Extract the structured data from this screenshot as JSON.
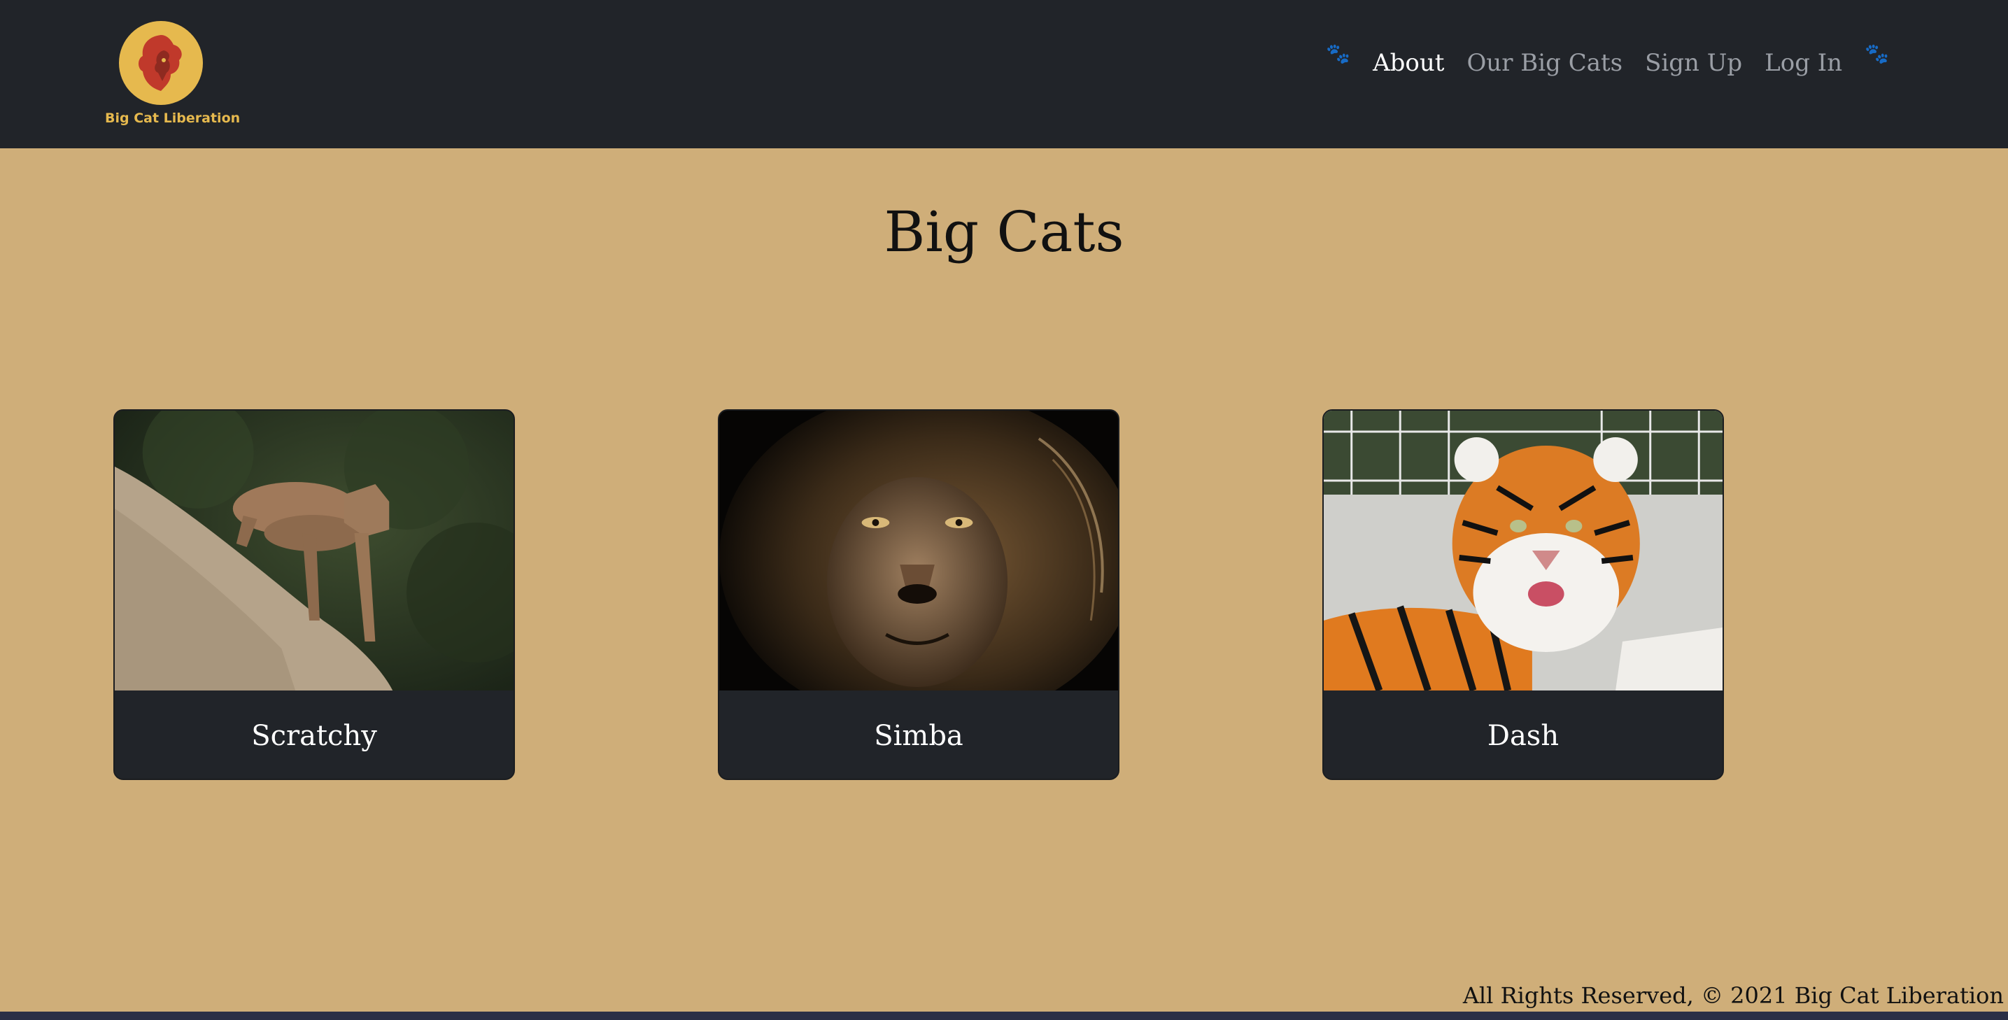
{
  "brand": {
    "name": "Big Cat Liberation",
    "logo_icon": "lion-head-icon",
    "accent": "#e6b94e"
  },
  "nav": {
    "items": [
      {
        "label": "About",
        "active": true
      },
      {
        "label": "Our Big Cats",
        "active": false
      },
      {
        "label": "Sign Up",
        "active": false
      },
      {
        "label": "Log In",
        "active": false
      }
    ],
    "paw_glyph": "🐾"
  },
  "page": {
    "title": "Big Cats",
    "background": "#cfae79"
  },
  "cats": [
    {
      "name": "Scratchy",
      "photo": "cougar-on-rock"
    },
    {
      "name": "Simba",
      "photo": "lion-portrait"
    },
    {
      "name": "Dash",
      "photo": "tiger-lying-in-snow"
    }
  ],
  "footer": {
    "text": "All Rights Reserved, © 2021 Big Cat Liberation"
  }
}
